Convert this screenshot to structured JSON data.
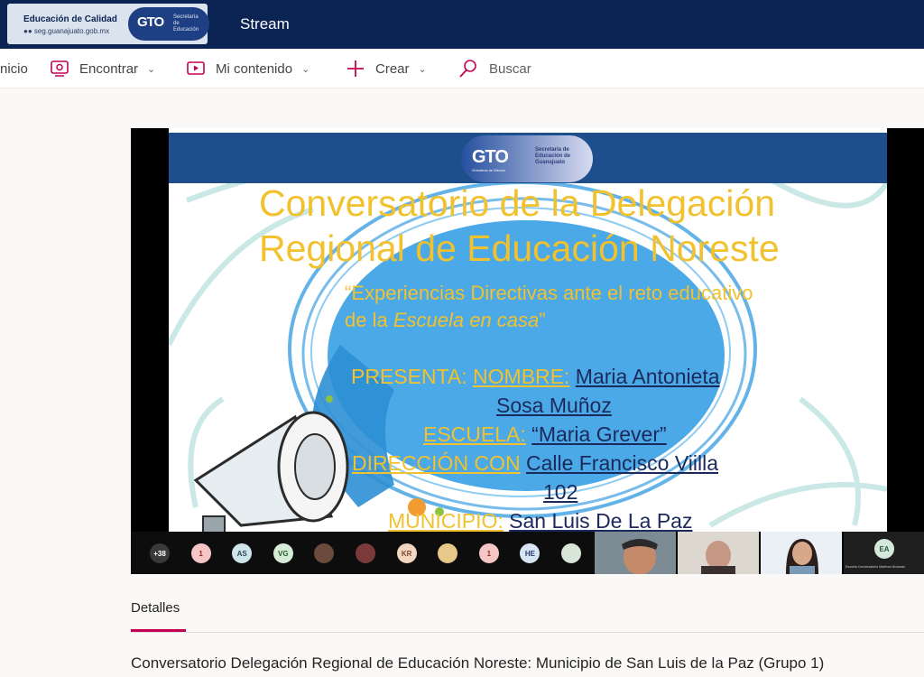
{
  "brand": {
    "title": "Educación de Calidad",
    "url": "seg.guanajuato.gob.mx",
    "logo_text": "GTO",
    "secretaria": "Secretaría de Educación"
  },
  "app_title": "Stream",
  "toolbar": {
    "inicio": "nicio",
    "encontrar": "Encontrar",
    "mi_contenido": "Mi contenido",
    "crear": "Crear",
    "buscar": "Buscar"
  },
  "slide": {
    "badge_logo": "GTO",
    "badge_tagline": "Grandeza de México",
    "badge_secretaria": "Secretaría de Educación de Guanajuato",
    "title_line1": "Conversatorio de la Delegación",
    "title_line2": "Regional de Educación Noreste",
    "quote_a": "“Experiencias Directivas ante el reto educativo de la ",
    "quote_em": "Escuela en casa",
    "quote_b": "”",
    "presenta_label": "PRESENTA:",
    "nombre_label": "NOMBRE:",
    "nombre_value_1": "Maria Antonieta",
    "nombre_value_2": "Sosa Muñoz",
    "escuela_label": "ESCUELA:",
    "escuela_value": "“Maria Grever”",
    "direccion_label": "DIRECCIÓN CON",
    "direccion_value_1": "Calle Francisco Viilla",
    "direccion_value_2": "102",
    "municipio_label": "MUNICIPIO:",
    "municipio_value": "San Luis De La Paz"
  },
  "participants": [
    {
      "label": "+38",
      "color": "#3a3a3a",
      "text_color": "#ffffff"
    },
    {
      "label": "1",
      "color": "#f6c6c6",
      "text_color": "#8a2a2a"
    },
    {
      "label": "AS",
      "color": "#cfe3ea",
      "text_color": "#2a4a5a"
    },
    {
      "label": "VG",
      "color": "#d6ecd6",
      "text_color": "#2a5a2a"
    },
    {
      "label": "",
      "color": "#6a4a3a",
      "text_color": "#ffffff"
    },
    {
      "label": "",
      "color": "#7a3a3a",
      "text_color": "#ffffff"
    },
    {
      "label": "KR",
      "color": "#f3d6c2",
      "text_color": "#7a4a2a"
    },
    {
      "label": "",
      "color": "#e8c88a",
      "text_color": "#ffffff"
    },
    {
      "label": "1",
      "color": "#f6c6c6",
      "text_color": "#8a2a2a"
    },
    {
      "label": "HE",
      "color": "#d6e4f3",
      "text_color": "#2a3a6a"
    },
    {
      "label": "",
      "color": "#d8e6d8",
      "text_color": "#2a5a2a"
    }
  ],
  "video_tiles": {
    "last_initials": "EA",
    "last_name": "Escuela Conversatorio Martínez Alvarado"
  },
  "details_tab": "Detalles",
  "video_title": "Conversatorio Delegación Regional de Educación Noreste: Municipio de San Luis de la Paz (Grupo 1)"
}
